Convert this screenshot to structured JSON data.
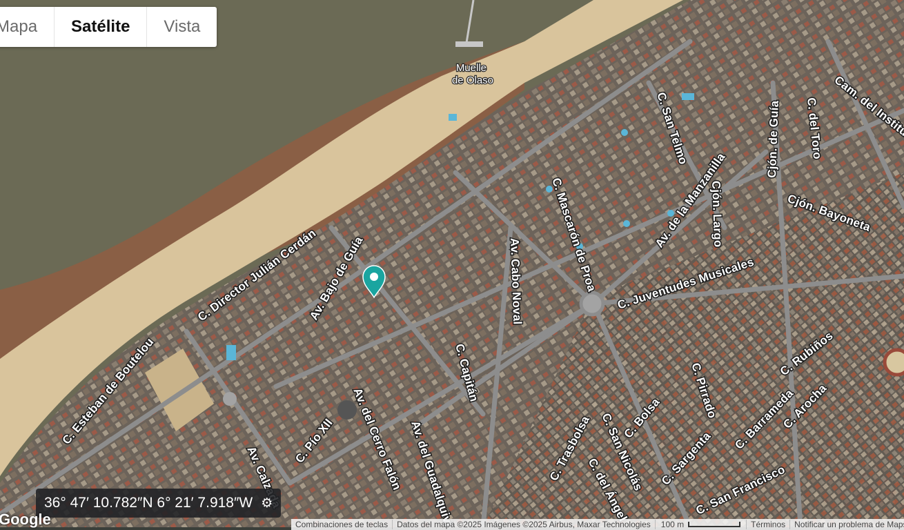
{
  "map_type": {
    "buttons": [
      {
        "label": "Mapa",
        "active": false
      },
      {
        "label": "Satélite",
        "active": true
      },
      {
        "label": "Vista",
        "active": false
      }
    ]
  },
  "map": {
    "poi_label": "Muelle\nde Olaso",
    "marker_color": "#1aa5a0",
    "street_labels": [
      "C. Director Julián Cerdán",
      "Av. Bajo de Guía",
      "Av. Cabo Noval",
      "C. Mascarón de Proa",
      "Av. de la Manzanilla",
      "C. San Telmo",
      "Cjón. de Guía",
      "C. del Toro",
      "Cam. del Instituto",
      "Cjón. Bayoneta",
      "Cjón. Largo",
      "C. Juventudes Musicales",
      "C. Esteban de Boutelou",
      "C. Capitán",
      "Av. del Cerro Falón",
      "Av. del Guadalquivir",
      "C. Pío XII",
      "Av. Calzada",
      "C. Trasbolsa",
      "C. San Nicolás",
      "C. del Ángel",
      "C. Bolsa",
      "C. Sargenta",
      "C. Pirrado",
      "C. Barrameda",
      "C. Arocha",
      "C. Rubiños",
      "C. San Francisco"
    ]
  },
  "coordinates": {
    "text": "36° 47′ 10.782″N 6° 21′ 7.918″W"
  },
  "logo_text": "Google",
  "footer": {
    "shortcuts": "Combinaciones de teclas",
    "map_data": "Datos del mapa ©2025 Imágenes ©2025 Airbus, Maxar Technologies",
    "scale": "100 m",
    "terms": "Términos",
    "report": "Notificar un problema de Maps"
  },
  "colors": {
    "water": "#6b6a55",
    "sand": "#d9c49c",
    "urban": "#6b6258",
    "road": "#8d8d8d"
  }
}
